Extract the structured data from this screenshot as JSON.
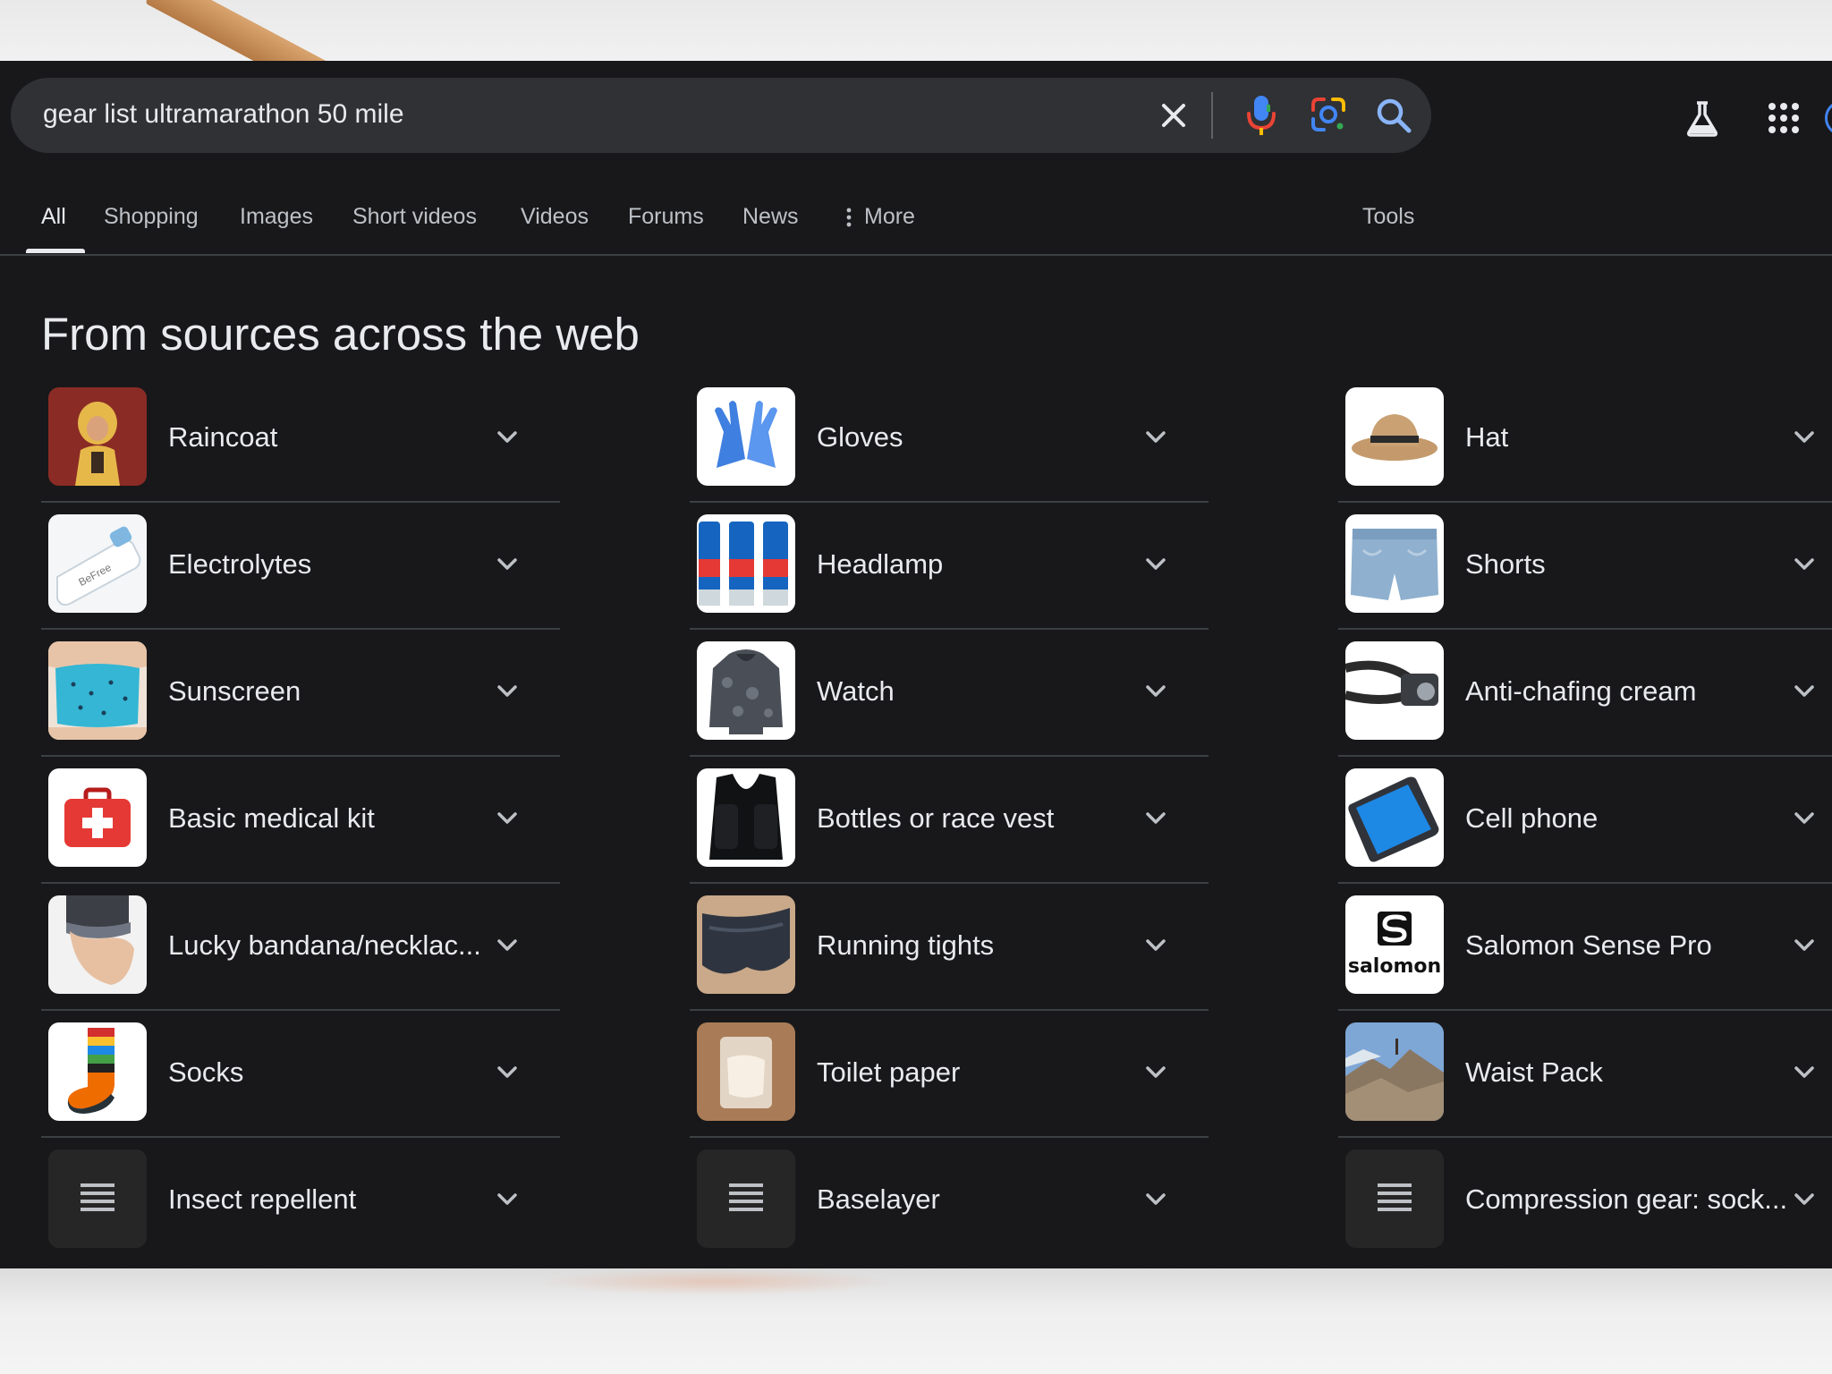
{
  "search": {
    "query": "gear list ultramarathon 50 mile"
  },
  "tabs": [
    {
      "label": "All"
    },
    {
      "label": "Shopping"
    },
    {
      "label": "Images"
    },
    {
      "label": "Short videos"
    },
    {
      "label": "Videos"
    },
    {
      "label": "Forums"
    },
    {
      "label": "News"
    },
    {
      "label": "More"
    },
    {
      "label": "Tools"
    }
  ],
  "section": {
    "title": "From sources across the web"
  },
  "columns": [
    {
      "items": [
        {
          "label": "Raincoat",
          "icon": "raincoat-thumbnail"
        },
        {
          "label": "Electrolytes",
          "icon": "electrolytes-thumbnail"
        },
        {
          "label": "Sunscreen",
          "icon": "sunscreen-thumbnail"
        },
        {
          "label": "Basic medical kit",
          "icon": "medical-kit-thumbnail"
        },
        {
          "label": "Lucky bandana/necklac...",
          "icon": "bandana-thumbnail"
        },
        {
          "label": "Socks",
          "icon": "socks-thumbnail"
        },
        {
          "label": "Insect repellent",
          "icon": "text-lines-icon"
        }
      ]
    },
    {
      "items": [
        {
          "label": "Gloves",
          "icon": "gloves-thumbnail"
        },
        {
          "label": "Headlamp",
          "icon": "headlamp-thumbnail"
        },
        {
          "label": "Watch",
          "icon": "watch-thumbnail"
        },
        {
          "label": "Bottles or race vest",
          "icon": "race-vest-thumbnail"
        },
        {
          "label": "Running tights",
          "icon": "running-tights-thumbnail"
        },
        {
          "label": "Toilet paper",
          "icon": "toilet-paper-thumbnail"
        },
        {
          "label": "Baselayer",
          "icon": "text-lines-icon"
        }
      ]
    },
    {
      "items": [
        {
          "label": "Hat",
          "icon": "hat-thumbnail"
        },
        {
          "label": "Shorts",
          "icon": "shorts-thumbnail"
        },
        {
          "label": "Anti-chafing cream",
          "icon": "anti-chafing-thumbnail"
        },
        {
          "label": "Cell phone",
          "icon": "cell-phone-thumbnail"
        },
        {
          "label": "Salomon Sense Pro",
          "icon": "salomon-logo-thumbnail"
        },
        {
          "label": "Waist Pack",
          "icon": "waist-pack-thumbnail"
        },
        {
          "label": "Compression gear: sock...",
          "icon": "text-lines-icon"
        }
      ]
    }
  ],
  "logos": {
    "salomon": "salomon"
  },
  "colors": {
    "background": "#18181a",
    "search_box": "#303134",
    "text": "#e8eaed",
    "muted_text": "#bdc1c6",
    "rule": "#3c4043",
    "google_blue": "#4285f4",
    "google_red": "#ea4335",
    "google_yellow": "#fbbc04",
    "google_green": "#34a853"
  }
}
